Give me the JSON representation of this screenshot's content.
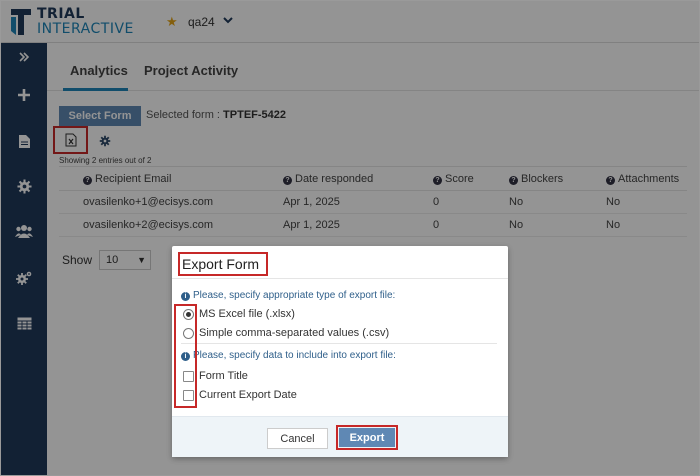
{
  "header": {
    "logo_line1": "TRIAL",
    "logo_line2": "INTERACTIVE",
    "study_name": "qa24"
  },
  "sidebar": {
    "items": [
      "collapse-icon",
      "add-icon",
      "document-icon",
      "gear-icon",
      "users-icon",
      "settings-icon",
      "table-icon"
    ]
  },
  "tabs": [
    {
      "label": "Analytics",
      "active": true
    },
    {
      "label": "Project Activity",
      "active": false
    }
  ],
  "form_bar": {
    "select_form_label": "Select Form",
    "selected_prefix": "Selected form :",
    "selected_value": "TPTEF-5422"
  },
  "entries_text": "Showing 2 entries out of 2",
  "table": {
    "headers": [
      "Recipient Email",
      "Date responded",
      "Score",
      "Blockers",
      "Attachments"
    ],
    "rows": [
      [
        "ovasilenko+1@ecisys.com",
        "Apr 1, 2025",
        "0",
        "No",
        "No"
      ],
      [
        "ovasilenko+2@ecisys.com",
        "Apr 1, 2025",
        "0",
        "No",
        "No"
      ]
    ]
  },
  "pager": {
    "show_label": "Show",
    "page_size": "10"
  },
  "modal": {
    "title": "Export Form",
    "type_hint": "Please, specify appropriate type of export file:",
    "type_options": [
      {
        "label": "MS Excel file (.xlsx)",
        "checked": true
      },
      {
        "label": "Simple comma-separated values (.csv)",
        "checked": false
      }
    ],
    "data_hint": "Please, specify data to include into export file:",
    "data_options": [
      {
        "label": "Form Title",
        "checked": false
      },
      {
        "label": "Current Export Date",
        "checked": false
      }
    ],
    "cancel_label": "Cancel",
    "export_label": "Export"
  },
  "colors": {
    "sidebar": "#1f3a5a",
    "accent": "#1e86b8",
    "button": "#5f88b4",
    "highlight": "#c62828",
    "star": "#e3a418"
  }
}
